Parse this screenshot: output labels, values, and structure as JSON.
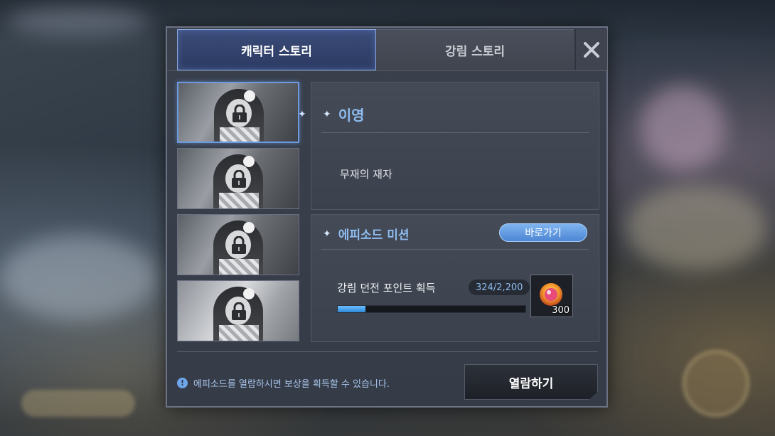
{
  "tabs": [
    {
      "label": "캐릭터 스토리",
      "active": true
    },
    {
      "label": "강림 스토리",
      "active": false
    }
  ],
  "close_icon": "close-icon",
  "thumbnails": [
    {
      "locked": true,
      "selected": true
    },
    {
      "locked": true,
      "selected": false
    },
    {
      "locked": true,
      "selected": false
    },
    {
      "locked": true,
      "selected": false
    }
  ],
  "character": {
    "name": "이영",
    "subtitle": "무재의 재자"
  },
  "mission": {
    "title": "에피소드 미션",
    "goto_label": "바로가기",
    "task_label": "강림 던전 포인트 획득",
    "progress_text": "324/2,200",
    "progress_fraction": 0.147,
    "reward_count": "300"
  },
  "footer": {
    "notice": "에피소드를 열람하시면 보상을 획득할 수 있습니다.",
    "unlock_label": "열람하기"
  },
  "colors": {
    "accent_blue": "#8ebcf0",
    "button_blue": "#4d86d4",
    "progress_fill": "#2d88d8"
  }
}
